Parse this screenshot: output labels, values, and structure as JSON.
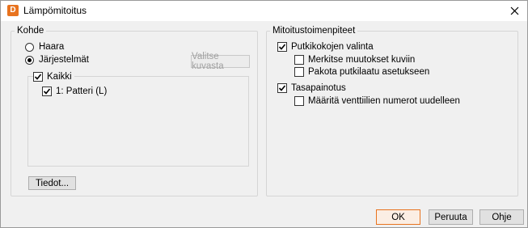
{
  "window": {
    "app_icon_letter": "D",
    "title": "Lämpömitoitus",
    "close_glyph": "close-icon"
  },
  "kohde": {
    "legend": "Kohde",
    "radio_haara": "Haara",
    "radio_jarjestelmat": "Järjestelmät",
    "selected": "Järjestelmät",
    "valitse_button": "Valitse kuvasta",
    "tree_all": "Kaikki",
    "tree_items": [
      "1: Patteri (L)"
    ],
    "tiedot_button": "Tiedot..."
  },
  "mitoitus": {
    "legend": "Mitoitustoimenpiteet",
    "putkikoko": "Putkikokojen valinta",
    "merkitse": "Merkitse muutokset kuviin",
    "pakota": "Pakota putkilaatu asetukseen",
    "tasapainotus": "Tasapainotus",
    "maarita": "Määritä venttiilien numerot uudelleen"
  },
  "buttons": {
    "ok": "OK",
    "peruuta": "Peruuta",
    "ohje": "Ohje"
  },
  "colors": {
    "accent": "#e8731f"
  }
}
